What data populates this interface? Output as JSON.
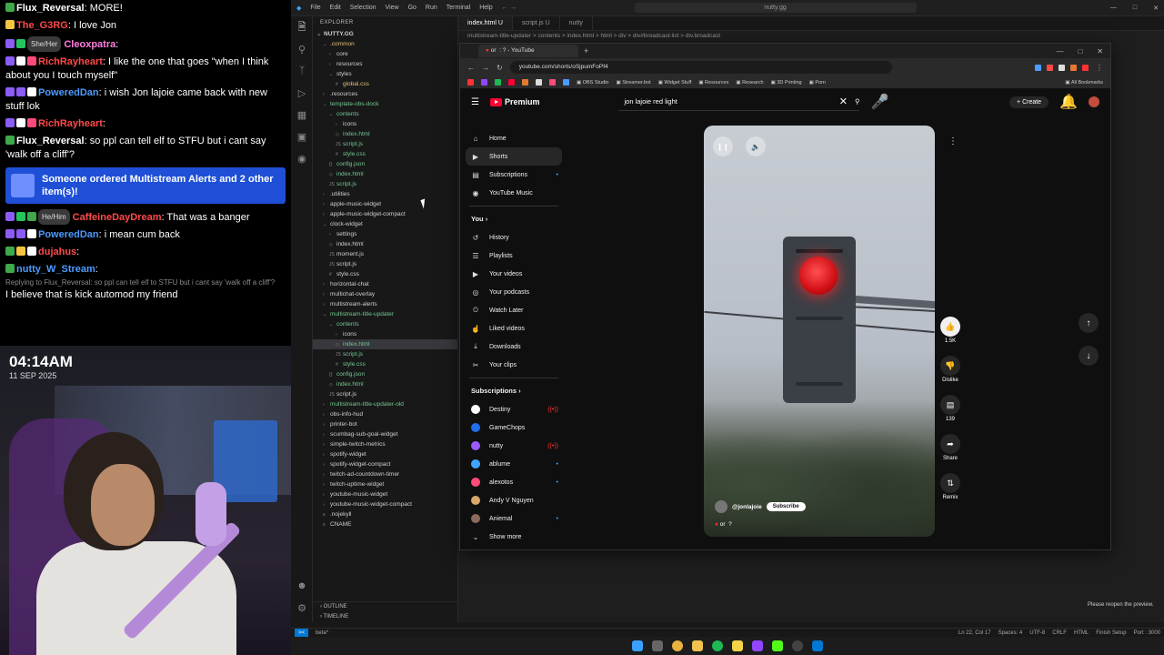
{
  "chat": {
    "messages": [
      {
        "user": "Flux_Reversal",
        "color": "#ffffff",
        "text": ": MORE!",
        "badges": [
          "#3ea84a"
        ]
      },
      {
        "user": "The_G3RG",
        "color": "#ff4a4a",
        "text": ": I love Jon",
        "badges": [
          "#f5c542"
        ]
      },
      {
        "user": "Cleoxpatra",
        "color": "#ff7de0",
        "text": ":",
        "pronoun": "She/Her",
        "badges": [
          "#8b5cf6",
          "#22c55e"
        ]
      },
      {
        "user": "RichRayheart",
        "color": "#ff4a4a",
        "text": ": I like the one that goes \"when I think about you I touch myself\"",
        "badges": [
          "#8b5cf6",
          "#ffffff",
          "#ff4a7a"
        ],
        "wrap": true
      },
      {
        "user": "PoweredDan",
        "color": "#4d9bff",
        "text": ": i wish Jon lajoie came back with new stuff lok",
        "badges": [
          "#8b5cf6",
          "#8b5cf6",
          "#ffffff"
        ],
        "wrap": true
      },
      {
        "user": "RichRayheart",
        "color": "#ff4a4a",
        "text": ":",
        "badges": [
          "#8b5cf6",
          "#ffffff",
          "#ff4a7a"
        ]
      },
      {
        "user": "Flux_Reversal",
        "color": "#ffffff",
        "text": ": so ppl can tell elf to STFU but i cant say 'walk off a cliff'?",
        "badges": [
          "#3ea84a"
        ],
        "wrap": true
      }
    ],
    "alert": "Someone ordered Multistream Alerts and 2 other item(s)!",
    "messages2": [
      {
        "user": "CaffeineDayDream",
        "color": "#ff4a4a",
        "text": ": That was a banger",
        "pronoun": "He/Him",
        "badges": [
          "#8b5cf6",
          "#22c55e",
          "#3ea84a"
        ]
      },
      {
        "user": "PoweredDan",
        "color": "#4d9bff",
        "text": ": i mean cum back",
        "badges": [
          "#8b5cf6",
          "#8b5cf6",
          "#ffffff"
        ]
      },
      {
        "user": "dujahus",
        "color": "#ff4a4a",
        "text": ":",
        "badges": [
          "#3ea84a",
          "#f5c542",
          "#ffffff"
        ]
      },
      {
        "user": "nutty_W_Stream",
        "color": "#4d9bff",
        "text": ":",
        "badges": [
          "#3ea84a"
        ]
      }
    ],
    "reply_to": "Replying to Flux_Reversal: so ppl can tell elf to STFU but i cant say 'walk off a cliff'?",
    "last_text": "I believe that is kick automod my friend"
  },
  "clock": {
    "time": "04:14AM",
    "date": "11 SEP 2025"
  },
  "vscode": {
    "menu": [
      "File",
      "Edit",
      "Selection",
      "View",
      "Go",
      "Run",
      "Terminal",
      "Help"
    ],
    "search": "nutty.gg",
    "explorer_title": "EXPLORER",
    "root": "NUTTY.GG",
    "tree": [
      {
        "label": ".common",
        "depth": 1,
        "kind": "folder-open",
        "cls": "t-orange"
      },
      {
        "label": "core",
        "depth": 2,
        "kind": "folder"
      },
      {
        "label": "resources",
        "depth": 2,
        "kind": "folder"
      },
      {
        "label": "styles",
        "depth": 2,
        "kind": "folder-open"
      },
      {
        "label": "global.css",
        "depth": 3,
        "kind": "css",
        "cls": "t-orange"
      },
      {
        "label": ".resources",
        "depth": 1,
        "kind": "folder"
      },
      {
        "label": "template-obs-dock",
        "depth": 1,
        "kind": "folder-open",
        "cls": "t-green"
      },
      {
        "label": "contents",
        "depth": 2,
        "kind": "folder-open",
        "cls": "t-green"
      },
      {
        "label": "icons",
        "depth": 3,
        "kind": "folder"
      },
      {
        "label": "index.html",
        "depth": 3,
        "kind": "html",
        "cls": "t-green"
      },
      {
        "label": "script.js",
        "depth": 3,
        "kind": "js",
        "cls": "t-green"
      },
      {
        "label": "style.css",
        "depth": 3,
        "kind": "css",
        "cls": "t-green"
      },
      {
        "label": "config.json",
        "depth": 2,
        "kind": "json",
        "cls": "t-green"
      },
      {
        "label": "index.html",
        "depth": 2,
        "kind": "html",
        "cls": "t-green"
      },
      {
        "label": "script.js",
        "depth": 2,
        "kind": "js",
        "cls": "t-green"
      },
      {
        "label": ".utilities",
        "depth": 1,
        "kind": "folder"
      },
      {
        "label": "apple-music-widget",
        "depth": 1,
        "kind": "folder"
      },
      {
        "label": "apple-music-widget-compact",
        "depth": 1,
        "kind": "folder"
      },
      {
        "label": "clock-widget",
        "depth": 1,
        "kind": "folder-open"
      },
      {
        "label": "settings",
        "depth": 2,
        "kind": "folder"
      },
      {
        "label": "index.html",
        "depth": 2,
        "kind": "html"
      },
      {
        "label": "moment.js",
        "depth": 2,
        "kind": "js"
      },
      {
        "label": "script.js",
        "depth": 2,
        "kind": "js"
      },
      {
        "label": "style.css",
        "depth": 2,
        "kind": "css"
      },
      {
        "label": "horizontal-chat",
        "depth": 1,
        "kind": "folder"
      },
      {
        "label": "multichat-overlay",
        "depth": 1,
        "kind": "folder"
      },
      {
        "label": "multistream-alerts",
        "depth": 1,
        "kind": "folder"
      },
      {
        "label": "multistream-title-updater",
        "depth": 1,
        "kind": "folder-open",
        "cls": "t-green"
      },
      {
        "label": "contents",
        "depth": 2,
        "kind": "folder-open",
        "cls": "t-green"
      },
      {
        "label": "icons",
        "depth": 3,
        "kind": "folder"
      },
      {
        "label": "index.html",
        "depth": 3,
        "kind": "html",
        "cls": "t-green",
        "selected": true
      },
      {
        "label": "script.js",
        "depth": 3,
        "kind": "js",
        "cls": "t-green"
      },
      {
        "label": "style.css",
        "depth": 3,
        "kind": "css",
        "cls": "t-green"
      },
      {
        "label": "config.json",
        "depth": 2,
        "kind": "json",
        "cls": "t-green"
      },
      {
        "label": "index.html",
        "depth": 2,
        "kind": "html",
        "cls": "t-green"
      },
      {
        "label": "script.js",
        "depth": 2,
        "kind": "js"
      },
      {
        "label": "multistream-title-updater-old",
        "depth": 1,
        "kind": "folder",
        "cls": "t-green"
      },
      {
        "label": "obs-info-hud",
        "depth": 1,
        "kind": "folder"
      },
      {
        "label": "printer-bot",
        "depth": 1,
        "kind": "folder"
      },
      {
        "label": "scumbag-sub-goal-widget",
        "depth": 1,
        "kind": "folder"
      },
      {
        "label": "simple-twitch-metrics",
        "depth": 1,
        "kind": "folder"
      },
      {
        "label": "spotify-widget",
        "depth": 1,
        "kind": "folder"
      },
      {
        "label": "spotify-widget-compact",
        "depth": 1,
        "kind": "folder"
      },
      {
        "label": "twitch-ad-countdown-timer",
        "depth": 1,
        "kind": "folder"
      },
      {
        "label": "twitch-uptime-widget",
        "depth": 1,
        "kind": "folder"
      },
      {
        "label": "youtube-music-widget",
        "depth": 1,
        "kind": "folder"
      },
      {
        "label": "youtube-music-widget-compact",
        "depth": 1,
        "kind": "folder"
      },
      {
        "label": ".nojekyll",
        "depth": 1,
        "kind": "file"
      },
      {
        "label": "CNAME",
        "depth": 1,
        "kind": "file"
      }
    ],
    "outline": "OUTLINE",
    "timeline": "TIMELINE",
    "tabs": [
      {
        "label": "index.html  U",
        "active": true
      },
      {
        "label": "script.js  U",
        "active": false
      },
      {
        "label": "nutty",
        "active": false
      }
    ],
    "breadcrumb": "multistream-title-updater > contents > index.html > html > div > div#broadcast-list > div.broadcast",
    "status_left": "beta*",
    "status_right": [
      "Ln 22, Col 17",
      "Spaces: 4",
      "UTF-8",
      "CRLF",
      "HTML",
      "Finish Setup",
      "Port : 3000"
    ],
    "toast": "Please reopen the preview."
  },
  "browser": {
    "tab_title": "or  : ? - YouTube",
    "url": "youtube.com/shorts/oSjpumFoPf4",
    "bookmarks": [
      "OBS Studio",
      "Streamer.bot",
      "Widget Stuff",
      "Resources",
      "Research",
      "3D Printing",
      "Porn",
      "All Bookmarks"
    ],
    "yt": {
      "logo": "Premium",
      "search_value": "jon lajoie red light",
      "create": "Create",
      "nav": [
        "Home",
        "Shorts",
        "Subscriptions",
        "YouTube Music"
      ],
      "you_head": "You",
      "you_items": [
        "History",
        "Playlists",
        "Your videos",
        "Your podcasts",
        "Watch Later",
        "Liked videos",
        "Downloads",
        "Your clips"
      ],
      "subs_head": "Subscriptions",
      "subs": [
        {
          "name": "Destiny",
          "color": "#ffffff",
          "dot": "red"
        },
        {
          "name": "GameChops",
          "color": "#1f6feb",
          "dot": ""
        },
        {
          "name": "nutty",
          "color": "#9b5cff",
          "dot": "red"
        },
        {
          "name": "ablume",
          "color": "#3ea6ff",
          "dot": "blue"
        },
        {
          "name": "alexotos",
          "color": "#ff4a7a",
          "dot": "blue"
        },
        {
          "name": "Andy V Nguyen",
          "color": "#d9a86a",
          "dot": ""
        },
        {
          "name": "Aniemal",
          "color": "#8a6a5a",
          "dot": "blue"
        }
      ],
      "show_more": "Show more",
      "channel": "@jonlajoie",
      "subscribe": "Subscribe",
      "caption": "or  ?",
      "likes": "1.5K",
      "dislike": "Dislike",
      "comments": "139",
      "share": "Share",
      "remix": "Remix"
    }
  }
}
